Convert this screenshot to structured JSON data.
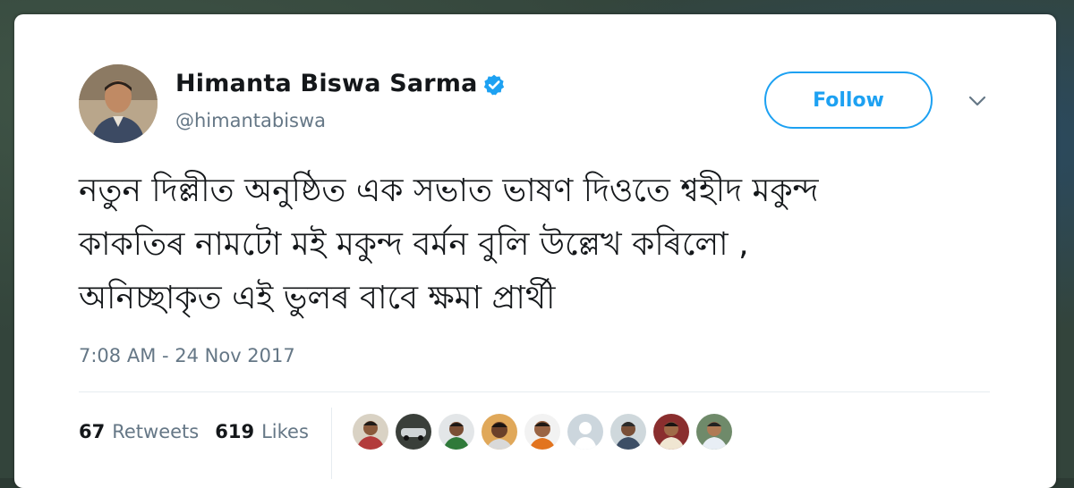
{
  "user": {
    "name": "Himanta Biswa Sarma",
    "handle": "@himantabiswa",
    "verified": true,
    "avatar_icon": "profile-photo"
  },
  "actions": {
    "follow_label": "Follow",
    "more_icon": "chevron-down-icon"
  },
  "tweet": {
    "lines": [
      "নতুন দিল্লীত অনুষ্ঠিত এক সভাত ভাষণ দিওতে শ্বহীদ মকুন্দ",
      "কাকতিৰ নামটো মই মকুন্দ বৰ্মন বুলি উল্লেখ কৰিলো ,",
      "অনিচ্ছাকৃত এই ভুলৰ বাবে ক্ষমা প্ৰাৰ্থী"
    ],
    "timestamp": "7:08 AM - 24 Nov 2017"
  },
  "stats": {
    "retweets_count": "67",
    "retweets_label": "Retweets",
    "likes_count": "619",
    "likes_label": "Likes"
  },
  "likers": [
    {
      "icon": "liker-avatar"
    },
    {
      "icon": "liker-avatar"
    },
    {
      "icon": "liker-avatar"
    },
    {
      "icon": "liker-avatar"
    },
    {
      "icon": "liker-avatar"
    },
    {
      "icon": "default-avatar"
    },
    {
      "icon": "liker-avatar"
    },
    {
      "icon": "liker-avatar"
    },
    {
      "icon": "liker-avatar"
    }
  ],
  "colors": {
    "accent": "#1da1f2",
    "text": "#14171a",
    "secondary": "#657786",
    "border": "#e6ecf0"
  }
}
